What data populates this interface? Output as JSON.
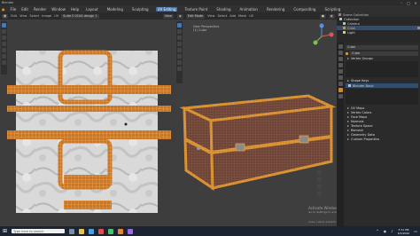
{
  "window": {
    "title": "Blender"
  },
  "menu": {
    "items": [
      "File",
      "Edit",
      "Render",
      "Window",
      "Help"
    ],
    "tabs": [
      "Layout",
      "Modeling",
      "Sculpting",
      "UV Editing",
      "Texture Paint",
      "Shading",
      "Animation",
      "Rendering",
      "Compositing",
      "Scripting"
    ],
    "active_tab": "UV Editing"
  },
  "uv_editor": {
    "header_items": [
      "Edit",
      "View",
      "Select",
      "Image",
      "UV"
    ],
    "image_name": "Suite 0 0104 design 1",
    "view_label": "View"
  },
  "viewport": {
    "header_items": [
      "Edit",
      "View",
      "Select",
      "Add",
      "Mesh",
      "UV"
    ],
    "mode": "Edit Mode",
    "overlay_title": "User Perspective",
    "overlay_object": "(1) Cube"
  },
  "outliner": {
    "title": "Scene Collection",
    "rows": [
      {
        "label": "Collection",
        "selected": false
      },
      {
        "label": "Camera",
        "selected": false
      },
      {
        "label": "Cube",
        "selected": true
      },
      {
        "label": "Light",
        "selected": false
      }
    ]
  },
  "properties": {
    "search_text": "Cube",
    "object_name": "Cube",
    "panels": [
      "Vertex Groups",
      "Shape Keys",
      "UV Maps",
      "Vertex Colors",
      "Face Maps",
      "Normals",
      "Texture Space",
      "Remesh",
      "Geometry Data",
      "Custom Properties"
    ],
    "material_label": "Blender Basic"
  },
  "activation": {
    "line1": "Activate Windows",
    "line2": "Go to Settings to activate Windows."
  },
  "status": {
    "text": "Cube | Verts 4,640/5,664 | Edges 9,280 | Faces 4,612 | Tris 9,192 | Objects 1/3"
  },
  "taskbar": {
    "search": "Type here to search",
    "time": "3:31 PM",
    "date": "6/3/2020"
  },
  "colors": {
    "accent": "#4a6f9e",
    "orange": "#e8a24a",
    "uv_wire": "#d9822b"
  }
}
